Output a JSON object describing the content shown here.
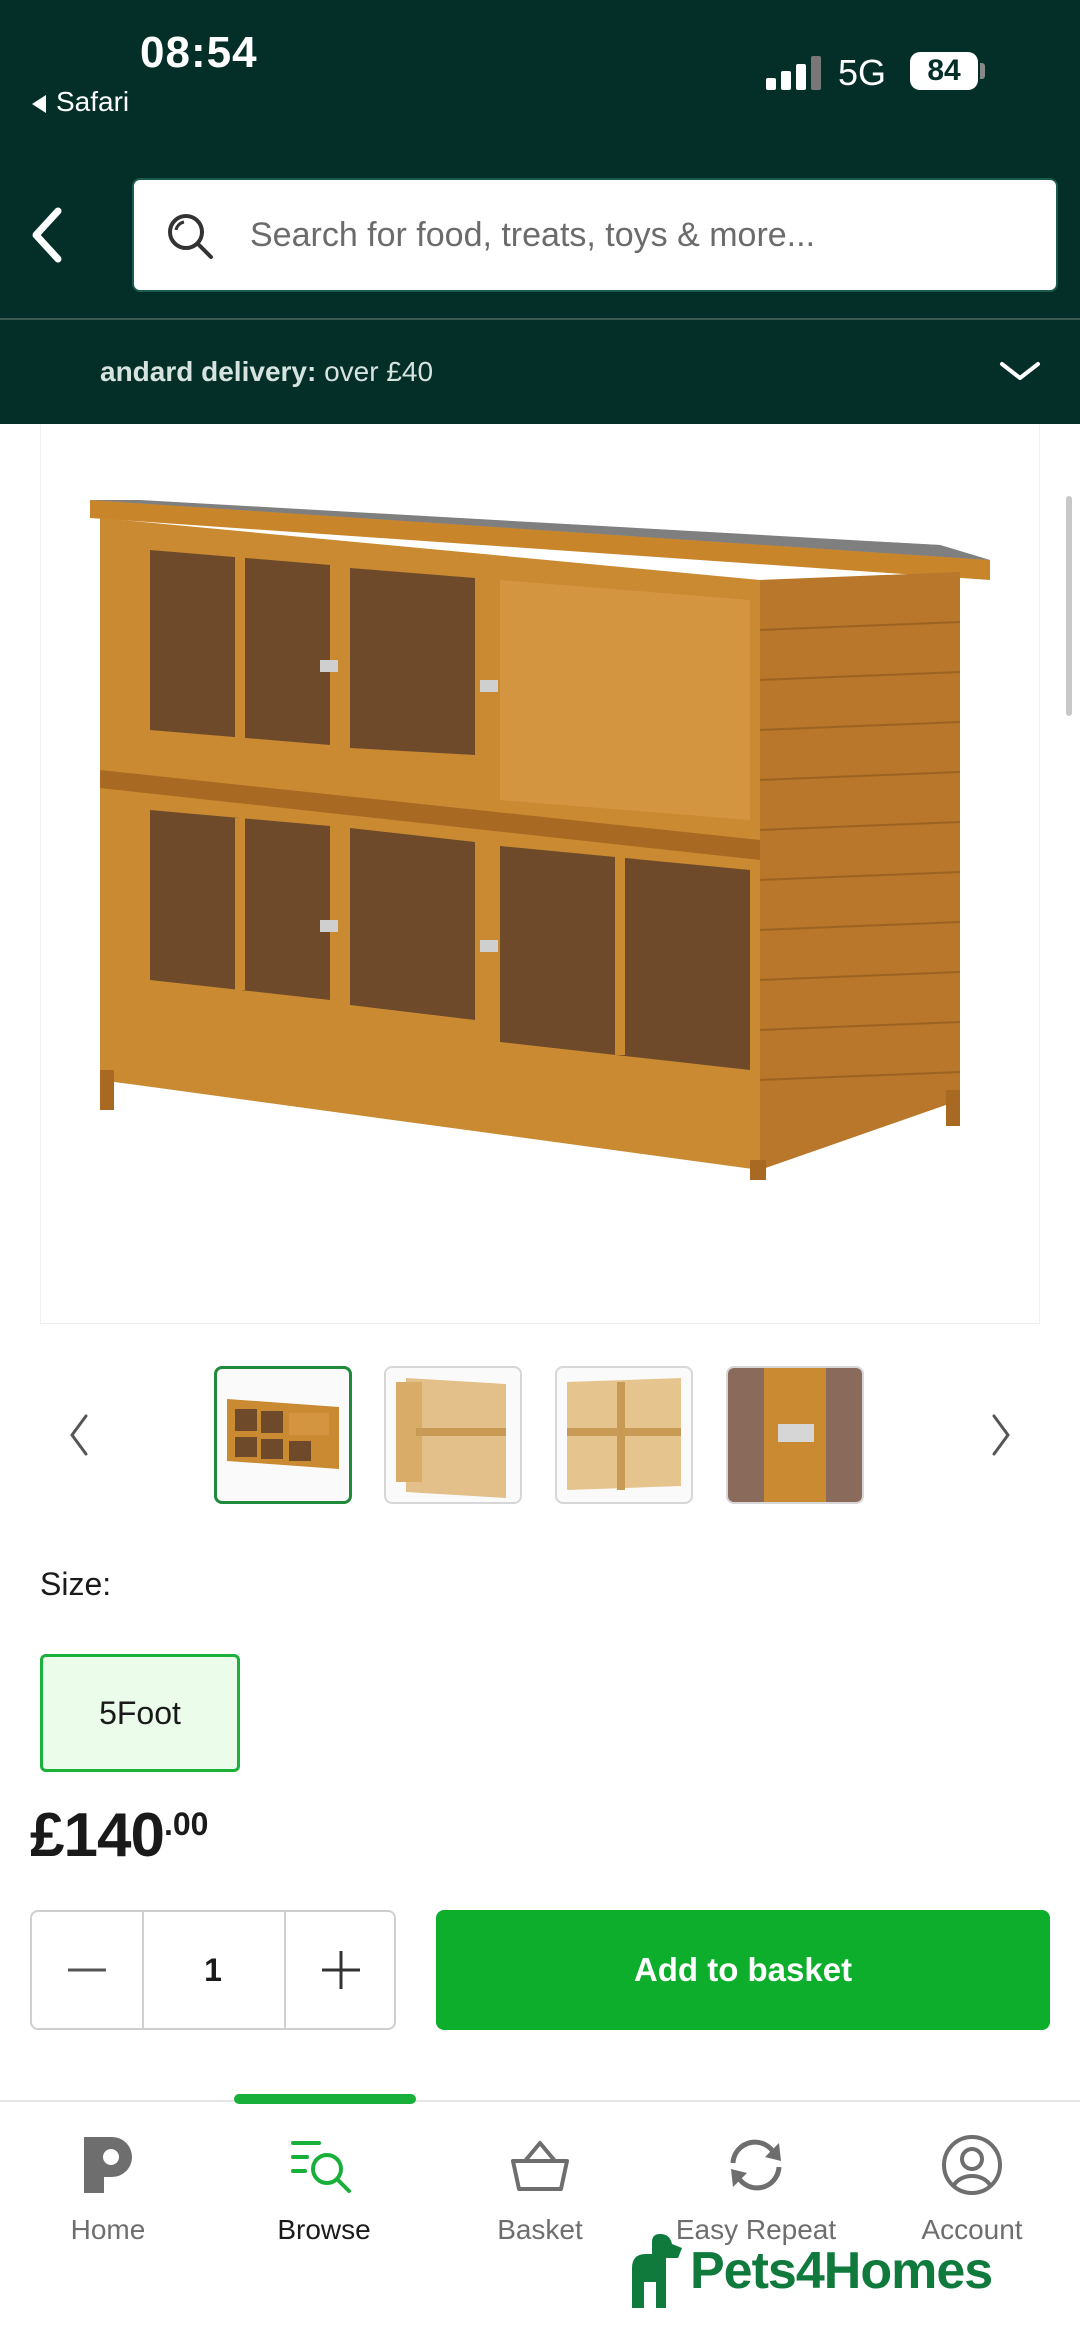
{
  "status_bar": {
    "time": "08:54",
    "back_app": "Safari",
    "network": "5G",
    "battery": "84"
  },
  "search": {
    "placeholder": "Search for food, treats, toys & more..."
  },
  "delivery": {
    "label": "andard delivery:",
    "detail": " over £40"
  },
  "product": {
    "main_image": "rabbit-hutch-product-image",
    "thumbnails": [
      "hutch-front-view",
      "hutch-open-view",
      "hutch-interior-view",
      "hutch-latch-closeup"
    ],
    "size_label": "Size:",
    "size_option": "5Foot",
    "price_main": "£140",
    "price_pence": ".00",
    "quantity": "1",
    "add_to_basket": "Add to basket"
  },
  "tabs": [
    {
      "label": "Home",
      "icon": "p-logo-icon"
    },
    {
      "label": "Browse",
      "icon": "browse-search-icon",
      "active": true
    },
    {
      "label": "Basket",
      "icon": "basket-icon"
    },
    {
      "label": "Easy Repeat",
      "icon": "repeat-icon"
    },
    {
      "label": "Account",
      "icon": "account-icon"
    }
  ],
  "brand": {
    "name": "Pets4Homes"
  },
  "colors": {
    "header": "#032f28",
    "accent": "#0cae2c",
    "brand": "#0f7a3c"
  }
}
